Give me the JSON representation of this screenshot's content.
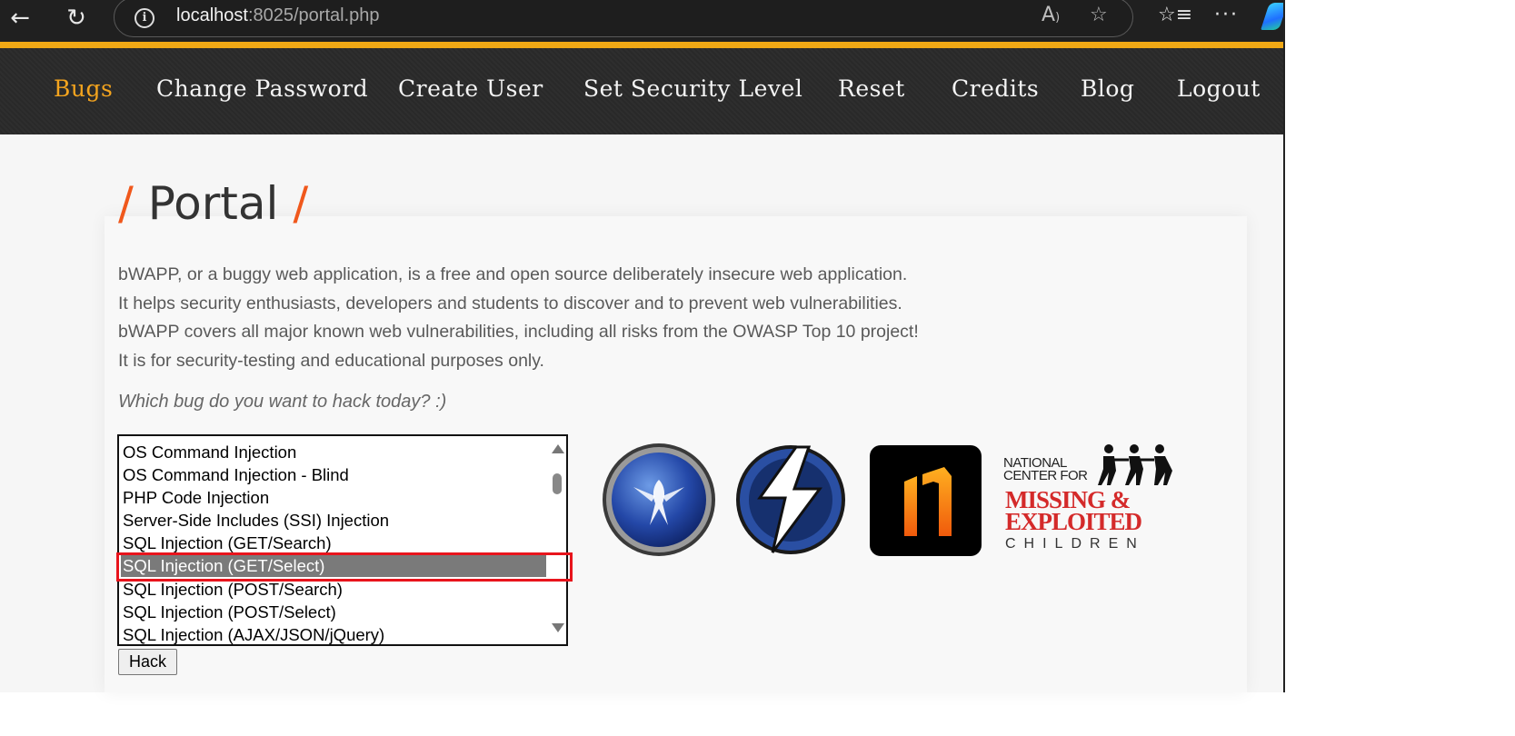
{
  "browser": {
    "back_icon": "back-arrow-icon",
    "reload_icon": "reload-icon",
    "url_host": "localhost",
    "url_rest": ":8025/portal.php",
    "read_aloud_label": "A",
    "toolbar_icons": [
      "read-aloud-icon",
      "favorite-star-icon",
      "favorites-list-icon",
      "more-icon",
      "copilot-icon"
    ]
  },
  "menu": {
    "items": [
      {
        "label": "Bugs",
        "active": true
      },
      {
        "label": "Change Password",
        "active": false
      },
      {
        "label": "Create User",
        "active": false
      },
      {
        "label": "Set Security Level",
        "active": false
      },
      {
        "label": "Reset",
        "active": false
      },
      {
        "label": "Credits",
        "active": false
      },
      {
        "label": "Blog",
        "active": false
      },
      {
        "label": "Logout",
        "active": false
      }
    ]
  },
  "page": {
    "title": "Portal",
    "title_slash": "/",
    "intro_lines": [
      "bWAPP, or a buggy web application, is a free and open source deliberately insecure web application.",
      "It helps security enthusiasts, developers and students to discover and to prevent web vulnerabilities.",
      "bWAPP covers all major known web vulnerabilities, including all risks from the OWASP Top 10 project!",
      "It is for security-testing and educational purposes only."
    ],
    "question": "Which bug do you want to hack today? :)"
  },
  "bug_list": {
    "options": [
      "OS Command Injection",
      "OS Command Injection - Blind",
      "PHP Code Injection",
      "Server-Side Includes (SSI) Injection",
      "SQL Injection (GET/Search)",
      "SQL Injection (GET/Select)",
      "SQL Injection (POST/Search)",
      "SQL Injection (POST/Select)",
      "SQL Injection (AJAX/JSON/jQuery)"
    ],
    "selected": "SQL Injection (GET/Select)"
  },
  "hack_button": "Hack",
  "logos": {
    "owasp": "owasp-logo",
    "zap": "zap-logo",
    "netsparker": "netsparker-logo",
    "ncmec_line1": "NATIONAL",
    "ncmec_line2": "CENTER FOR",
    "ncmec_line3": "MISSING &",
    "ncmec_line4": "EXPLOITED",
    "ncmec_line5": "CHILDREN"
  },
  "colors": {
    "accent_orange": "#f4a41e",
    "title_slash": "#f0581c",
    "highlight_red": "#e8141c",
    "selected_bg": "#7a7a7a",
    "ncmec_red": "#d42a2a"
  }
}
